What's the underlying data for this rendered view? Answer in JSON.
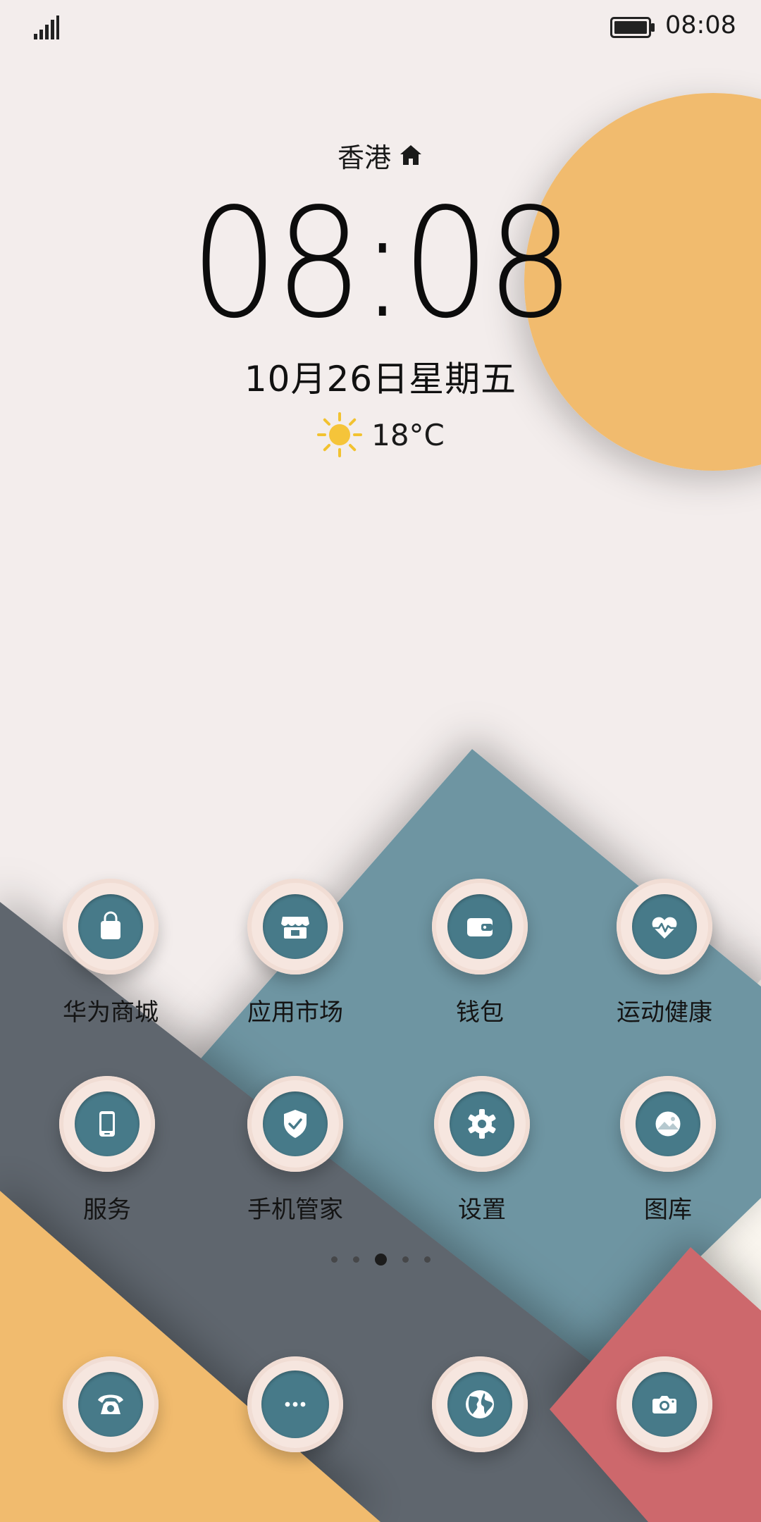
{
  "status_bar": {
    "time": "08:08",
    "battery_level": "full",
    "signal": "4-bars"
  },
  "clock_widget": {
    "city": "香港",
    "time": "08:08",
    "date": "10月26日星期五",
    "temperature": "18°C",
    "weather_icon": "sun-icon"
  },
  "apps": [
    {
      "label": "华为商城",
      "icon": "shopping-bag-icon"
    },
    {
      "label": "应用市场",
      "icon": "store-icon"
    },
    {
      "label": "钱包",
      "icon": "wallet-icon"
    },
    {
      "label": "运动健康",
      "icon": "heart-pulse-icon"
    },
    {
      "label": "服务",
      "icon": "phone-device-icon"
    },
    {
      "label": "手机管家",
      "icon": "shield-check-icon"
    },
    {
      "label": "设置",
      "icon": "gear-icon"
    },
    {
      "label": "图库",
      "icon": "gallery-icon"
    }
  ],
  "page_indicator": {
    "count": 5,
    "active": 3
  },
  "dock": [
    {
      "name": "phone",
      "icon": "telephone-icon"
    },
    {
      "name": "messages",
      "icon": "chat-bubble-icon"
    },
    {
      "name": "browser",
      "icon": "globe-icon"
    },
    {
      "name": "camera",
      "icon": "camera-icon"
    }
  ],
  "colors": {
    "background": "#f3edec",
    "sun": "#f1bb6e",
    "teal": "#6e95a2",
    "slate": "#5f666e",
    "orange": "#f1bb6e",
    "cream": "#fbf7f0",
    "red": "#cd686c",
    "icon_fill": "#477a89",
    "icon_ring": "#f6e6df"
  }
}
